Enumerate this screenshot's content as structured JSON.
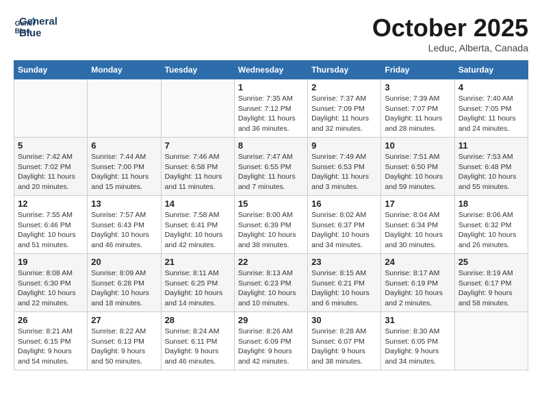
{
  "header": {
    "logo_line1": "General",
    "logo_line2": "Blue",
    "month": "October 2025",
    "location": "Leduc, Alberta, Canada"
  },
  "days_of_week": [
    "Sunday",
    "Monday",
    "Tuesday",
    "Wednesday",
    "Thursday",
    "Friday",
    "Saturday"
  ],
  "weeks": [
    [
      {
        "day": "",
        "info": ""
      },
      {
        "day": "",
        "info": ""
      },
      {
        "day": "",
        "info": ""
      },
      {
        "day": "1",
        "info": "Sunrise: 7:35 AM\nSunset: 7:12 PM\nDaylight: 11 hours\nand 36 minutes."
      },
      {
        "day": "2",
        "info": "Sunrise: 7:37 AM\nSunset: 7:09 PM\nDaylight: 11 hours\nand 32 minutes."
      },
      {
        "day": "3",
        "info": "Sunrise: 7:39 AM\nSunset: 7:07 PM\nDaylight: 11 hours\nand 28 minutes."
      },
      {
        "day": "4",
        "info": "Sunrise: 7:40 AM\nSunset: 7:05 PM\nDaylight: 11 hours\nand 24 minutes."
      }
    ],
    [
      {
        "day": "5",
        "info": "Sunrise: 7:42 AM\nSunset: 7:02 PM\nDaylight: 11 hours\nand 20 minutes."
      },
      {
        "day": "6",
        "info": "Sunrise: 7:44 AM\nSunset: 7:00 PM\nDaylight: 11 hours\nand 15 minutes."
      },
      {
        "day": "7",
        "info": "Sunrise: 7:46 AM\nSunset: 6:58 PM\nDaylight: 11 hours\nand 11 minutes."
      },
      {
        "day": "8",
        "info": "Sunrise: 7:47 AM\nSunset: 6:55 PM\nDaylight: 11 hours\nand 7 minutes."
      },
      {
        "day": "9",
        "info": "Sunrise: 7:49 AM\nSunset: 6:53 PM\nDaylight: 11 hours\nand 3 minutes."
      },
      {
        "day": "10",
        "info": "Sunrise: 7:51 AM\nSunset: 6:50 PM\nDaylight: 10 hours\nand 59 minutes."
      },
      {
        "day": "11",
        "info": "Sunrise: 7:53 AM\nSunset: 6:48 PM\nDaylight: 10 hours\nand 55 minutes."
      }
    ],
    [
      {
        "day": "12",
        "info": "Sunrise: 7:55 AM\nSunset: 6:46 PM\nDaylight: 10 hours\nand 51 minutes."
      },
      {
        "day": "13",
        "info": "Sunrise: 7:57 AM\nSunset: 6:43 PM\nDaylight: 10 hours\nand 46 minutes."
      },
      {
        "day": "14",
        "info": "Sunrise: 7:58 AM\nSunset: 6:41 PM\nDaylight: 10 hours\nand 42 minutes."
      },
      {
        "day": "15",
        "info": "Sunrise: 8:00 AM\nSunset: 6:39 PM\nDaylight: 10 hours\nand 38 minutes."
      },
      {
        "day": "16",
        "info": "Sunrise: 8:02 AM\nSunset: 6:37 PM\nDaylight: 10 hours\nand 34 minutes."
      },
      {
        "day": "17",
        "info": "Sunrise: 8:04 AM\nSunset: 6:34 PM\nDaylight: 10 hours\nand 30 minutes."
      },
      {
        "day": "18",
        "info": "Sunrise: 8:06 AM\nSunset: 6:32 PM\nDaylight: 10 hours\nand 26 minutes."
      }
    ],
    [
      {
        "day": "19",
        "info": "Sunrise: 8:08 AM\nSunset: 6:30 PM\nDaylight: 10 hours\nand 22 minutes."
      },
      {
        "day": "20",
        "info": "Sunrise: 8:09 AM\nSunset: 6:28 PM\nDaylight: 10 hours\nand 18 minutes."
      },
      {
        "day": "21",
        "info": "Sunrise: 8:11 AM\nSunset: 6:25 PM\nDaylight: 10 hours\nand 14 minutes."
      },
      {
        "day": "22",
        "info": "Sunrise: 8:13 AM\nSunset: 6:23 PM\nDaylight: 10 hours\nand 10 minutes."
      },
      {
        "day": "23",
        "info": "Sunrise: 8:15 AM\nSunset: 6:21 PM\nDaylight: 10 hours\nand 6 minutes."
      },
      {
        "day": "24",
        "info": "Sunrise: 8:17 AM\nSunset: 6:19 PM\nDaylight: 10 hours\nand 2 minutes."
      },
      {
        "day": "25",
        "info": "Sunrise: 8:19 AM\nSunset: 6:17 PM\nDaylight: 9 hours\nand 58 minutes."
      }
    ],
    [
      {
        "day": "26",
        "info": "Sunrise: 8:21 AM\nSunset: 6:15 PM\nDaylight: 9 hours\nand 54 minutes."
      },
      {
        "day": "27",
        "info": "Sunrise: 8:22 AM\nSunset: 6:13 PM\nDaylight: 9 hours\nand 50 minutes."
      },
      {
        "day": "28",
        "info": "Sunrise: 8:24 AM\nSunset: 6:11 PM\nDaylight: 9 hours\nand 46 minutes."
      },
      {
        "day": "29",
        "info": "Sunrise: 8:26 AM\nSunset: 6:09 PM\nDaylight: 9 hours\nand 42 minutes."
      },
      {
        "day": "30",
        "info": "Sunrise: 8:28 AM\nSunset: 6:07 PM\nDaylight: 9 hours\nand 38 minutes."
      },
      {
        "day": "31",
        "info": "Sunrise: 8:30 AM\nSunset: 6:05 PM\nDaylight: 9 hours\nand 34 minutes."
      },
      {
        "day": "",
        "info": ""
      }
    ]
  ]
}
